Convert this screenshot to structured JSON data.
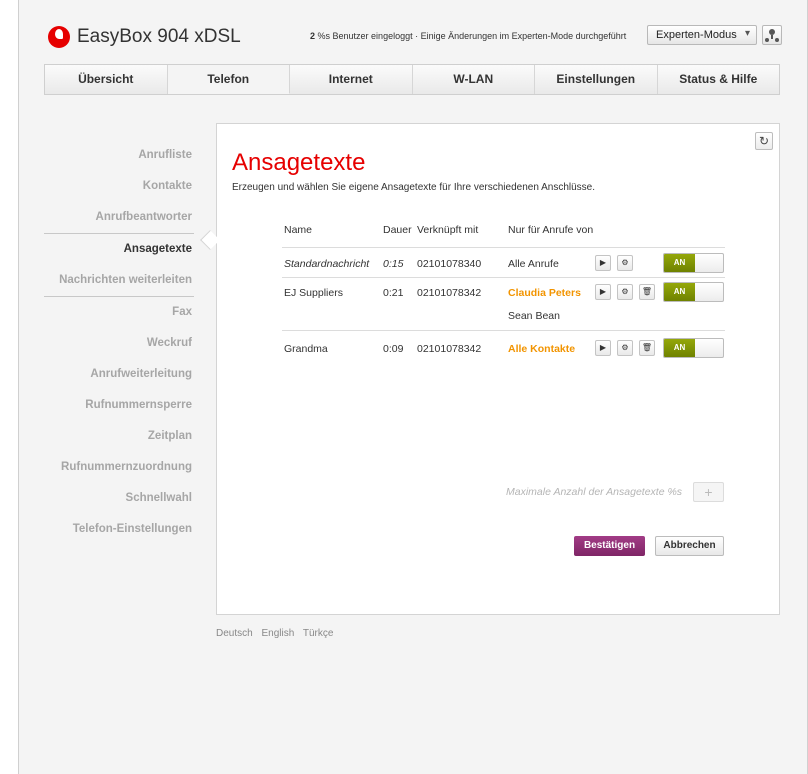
{
  "header": {
    "product_title": "EasyBox 904 xDSL",
    "status_count": "2",
    "status_text": "%s Benutzer eingeloggt · Einige Änderungen im Experten-Mode durchgeführt",
    "mode_select": "Experten-Modus",
    "logo_icon": "vodafone-logo",
    "user_icon": "user-icon"
  },
  "tabs": [
    {
      "label": "Übersicht",
      "active": false
    },
    {
      "label": "Telefon",
      "active": true
    },
    {
      "label": "Internet",
      "active": false
    },
    {
      "label": "W-LAN",
      "active": false
    },
    {
      "label": "Einstellungen",
      "active": false
    },
    {
      "label": "Status & Hilfe",
      "active": false
    }
  ],
  "sidebar": {
    "items": [
      {
        "label": "Anrufliste"
      },
      {
        "label": "Kontakte"
      },
      {
        "label": "Anrufbeantworter"
      },
      {
        "label": "Ansagetexte",
        "active": true
      },
      {
        "label": "Nachrichten weiterleiten"
      },
      {
        "label": "Fax"
      },
      {
        "label": "Weckruf"
      },
      {
        "label": "Anrufweiterleitung"
      },
      {
        "label": "Rufnummernsperre"
      },
      {
        "label": "Zeitplan"
      },
      {
        "label": "Rufnummernzuordnung"
      },
      {
        "label": "Schnellwahl"
      },
      {
        "label": "Telefon-Einstellungen"
      }
    ]
  },
  "main": {
    "title": "Ansagetexte",
    "description": "Erzeugen und wählen Sie eigene Ansagetexte für Ihre verschiedenen Anschlüsse.",
    "columns": [
      "Name",
      "Dauer",
      "Verknüpft mit",
      "Nur für Anrufe von"
    ],
    "rows": [
      {
        "name": "Standardnachricht",
        "duration": "0:15",
        "linked": "02101078340",
        "callers": [
          "Alle Anrufe"
        ],
        "toggle": "AN"
      },
      {
        "name": "EJ Suppliers",
        "duration": "0:21",
        "linked": "02101078342",
        "callers": [
          "Claudia Peters",
          "Sean Bean"
        ],
        "toggle": "AN"
      },
      {
        "name": "Grandma",
        "duration": "0:09",
        "linked": "02101078342",
        "callers": [
          "Alle Kontakte"
        ],
        "toggle": "AN"
      }
    ],
    "max_text": "Maximale Anzahl der Ansagetexte %s",
    "add_label": "+",
    "confirm_label": "Bestätigen",
    "cancel_label": "Abbrechen",
    "refresh_icon": "refresh-icon"
  },
  "footer": {
    "languages": [
      "Deutsch",
      "English",
      "Türkçe"
    ]
  },
  "colors": {
    "accent": "#e60000",
    "orange": "#f29400",
    "toggle_on": "#7f9200",
    "confirm": "#8e2f76"
  }
}
